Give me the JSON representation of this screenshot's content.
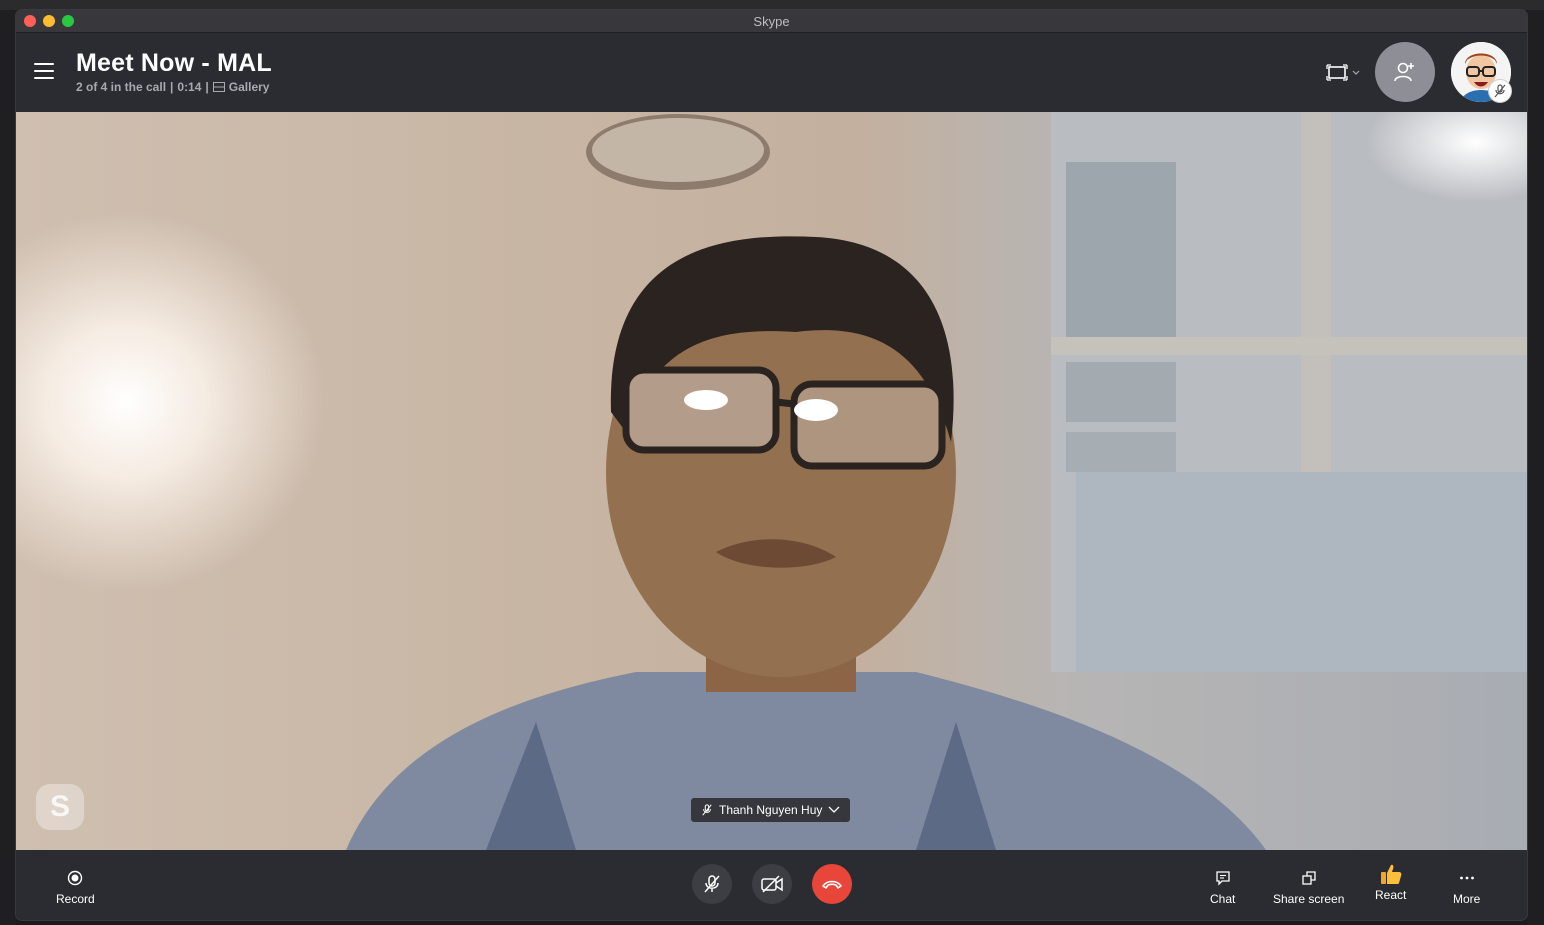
{
  "window": {
    "title": "Skype"
  },
  "header": {
    "call_title": "Meet Now - MAL",
    "participants": "2 of 4 in the call",
    "sep1": "|",
    "duration": "0:14",
    "sep2": "|",
    "view_mode": "Gallery"
  },
  "video": {
    "participant_name": "Thanh Nguyen Huy",
    "watermark": "S"
  },
  "controls": {
    "record_label": "Record",
    "chat_label": "Chat",
    "share_label": "Share screen",
    "react_label": "React",
    "more_label": "More"
  },
  "colors": {
    "end_call": "#e8463b",
    "background": "#2b2c31",
    "subtitle": "#a8a9b2"
  }
}
